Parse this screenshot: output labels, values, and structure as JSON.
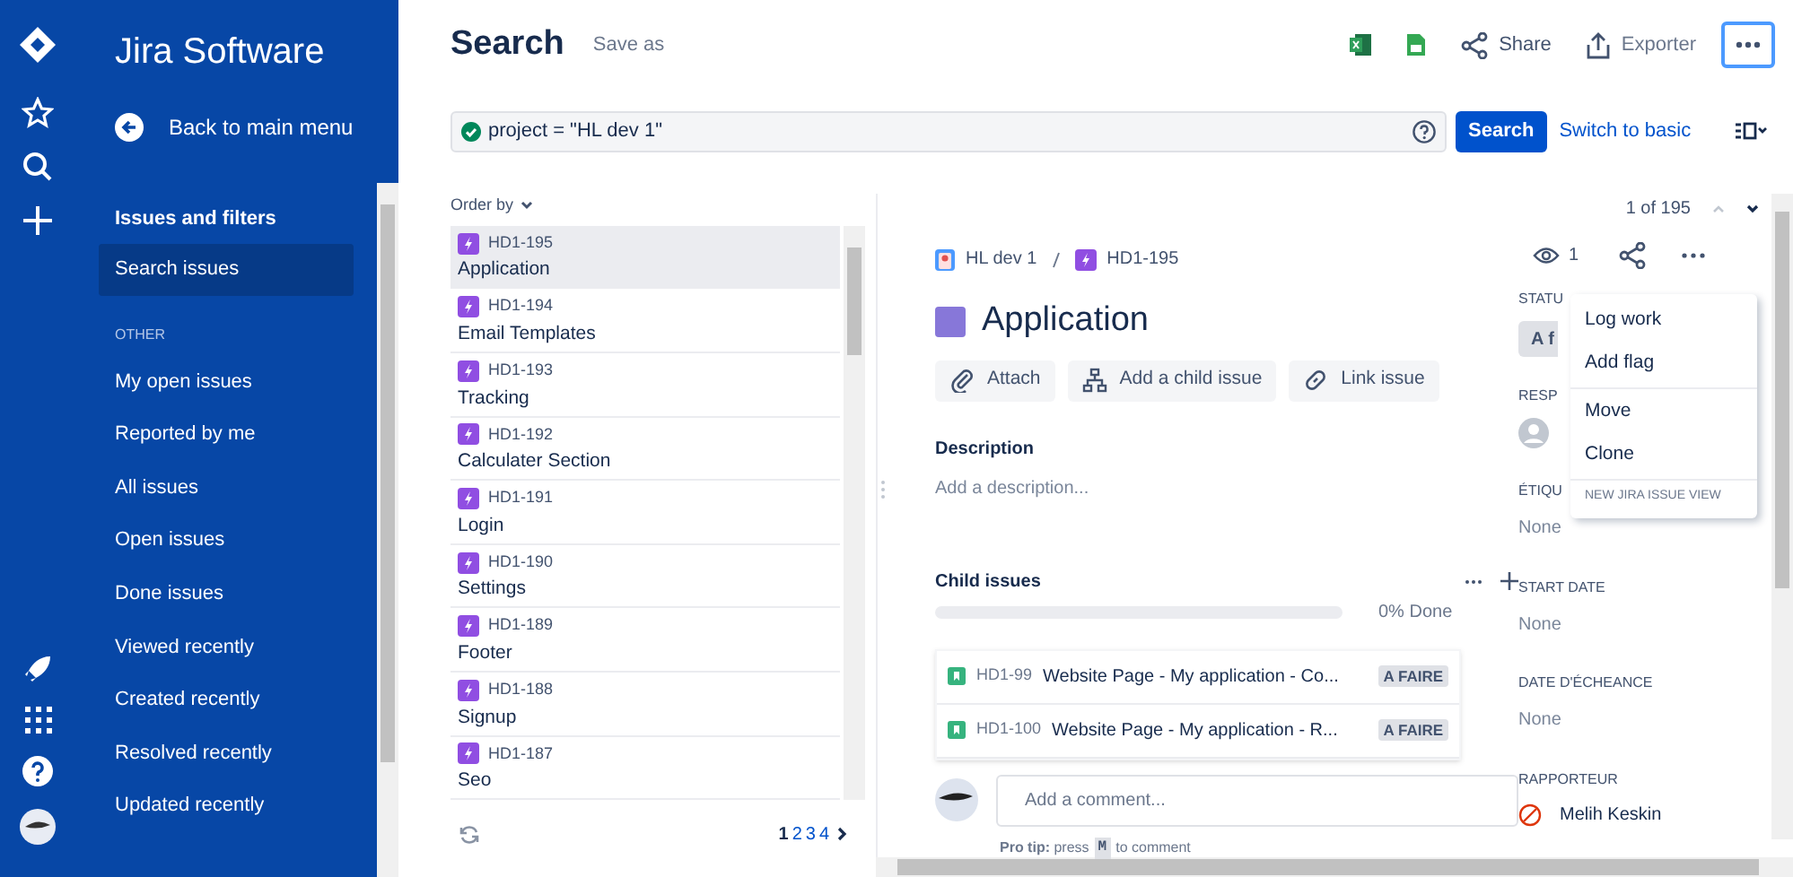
{
  "sidebar": {
    "title": "Jira Software",
    "back": "Back to main menu",
    "heading": "Issues and filters",
    "items": [
      {
        "label": "Search issues",
        "selected": true
      }
    ],
    "section": "OTHER",
    "other_items": [
      {
        "label": "My open issues",
        "selected": false
      },
      {
        "label": "Reported by me",
        "selected": false
      },
      {
        "label": "All issues",
        "selected": false
      },
      {
        "label": "Open issues",
        "selected": false
      },
      {
        "label": "Done issues",
        "selected": false
      },
      {
        "label": "Viewed recently",
        "selected": false
      },
      {
        "label": "Created recently",
        "selected": false
      },
      {
        "label": "Resolved recently",
        "selected": false
      },
      {
        "label": "Updated recently",
        "selected": false
      }
    ]
  },
  "header": {
    "title": "Search",
    "save_as": "Save as",
    "share": "Share",
    "export": "Exporter"
  },
  "query": {
    "value": "project = \"HL dev 1\"",
    "valid": true
  },
  "search_button": "Search",
  "switch_link": "Switch to basic",
  "results": {
    "order_by": "Order by",
    "issues": [
      {
        "key": "HD1-195",
        "summary": "Application",
        "selected": true
      },
      {
        "key": "HD1-194",
        "summary": "Email Templates",
        "selected": false
      },
      {
        "key": "HD1-193",
        "summary": "Tracking",
        "selected": false
      },
      {
        "key": "HD1-192",
        "summary": "Calculater Section",
        "selected": false
      },
      {
        "key": "HD1-191",
        "summary": "Login",
        "selected": false
      },
      {
        "key": "HD1-190",
        "summary": "Settings",
        "selected": false
      },
      {
        "key": "HD1-189",
        "summary": "Footer",
        "selected": false
      },
      {
        "key": "HD1-188",
        "summary": "Signup",
        "selected": false
      },
      {
        "key": "HD1-187",
        "summary": "Seo",
        "selected": false
      }
    ],
    "pages": [
      {
        "label": "1",
        "selected": true
      },
      {
        "label": "2",
        "selected": false
      },
      {
        "label": "3",
        "selected": false
      },
      {
        "label": "4",
        "selected": false
      }
    ]
  },
  "detail": {
    "counter": "1 of 195",
    "watchers": "1",
    "project": "HL dev 1",
    "key": "HD1-195",
    "title": "Application",
    "actions": [
      "Attach",
      "Add a child issue",
      "Link issue"
    ],
    "description_label": "Description",
    "description_placeholder": "Add a description...",
    "child_issues": {
      "title": "Child issues",
      "level": 0,
      "progress": "0% Done",
      "items": [
        {
          "key": "HD1-99",
          "summary": "Website Page - My application - Co...",
          "status": "A FAIRE"
        },
        {
          "key": "HD1-100",
          "summary": "Website Page - My application - R...",
          "status": "A FAIRE"
        }
      ]
    },
    "comment_placeholder": "Add a comment...",
    "pro_tip": "**Pro tip:** press",
    "pro_tip_key": "M",
    "pro_tip_end": "to comment"
  },
  "fields": [
    {
      "label": "STATU",
      "value": "A f",
      "kind": "status"
    },
    {
      "label": "RESP",
      "kind": "user"
    },
    {
      "label": "ÉTIQU",
      "value": "None",
      "kind": "text"
    },
    {
      "label": "START DATE",
      "value": "None",
      "kind": "text"
    },
    {
      "label": "DATE D'ÉCHEANCE",
      "value": "None",
      "kind": "text"
    },
    {
      "label": "RAPPORTEUR",
      "value": "Melih Keskin",
      "kind": "reporter"
    }
  ],
  "menu": {
    "groups": [
      [
        "Log work",
        "Add flag"
      ],
      [
        "Move",
        "Clone"
      ]
    ],
    "footer": "NEW JIRA ISSUE VIEW"
  }
}
